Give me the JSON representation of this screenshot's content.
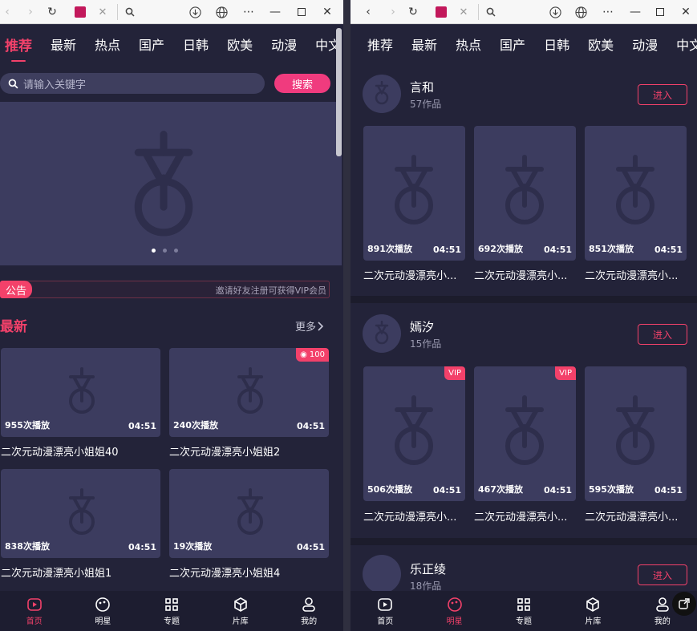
{
  "left": {
    "nav": [
      "推荐",
      "最新",
      "热点",
      "国产",
      "日韩",
      "欧美",
      "动漫",
      "中文"
    ],
    "search": {
      "placeholder": "请输入关键字",
      "button": "搜索"
    },
    "notice": {
      "tag": "公告",
      "text": "邀请好友注册可获得VIP会员"
    },
    "section": {
      "title": "最新",
      "more": "更多"
    },
    "videos": [
      {
        "plays": "955次播放",
        "duration": "04:51",
        "title": "二次元动漫漂亮小姐姐40"
      },
      {
        "plays": "240次播放",
        "duration": "04:51",
        "title": "二次元动漫漂亮小姐姐2",
        "badge": "100"
      },
      {
        "plays": "838次播放",
        "duration": "04:51",
        "title": "二次元动漫漂亮小姐姐1"
      },
      {
        "plays": "19次播放",
        "duration": "04:51",
        "title": "二次元动漫漂亮小姐姐4"
      }
    ],
    "tabs": [
      "首页",
      "明星",
      "专题",
      "片库",
      "我的"
    ]
  },
  "right": {
    "nav": [
      "推荐",
      "最新",
      "热点",
      "国产",
      "日韩",
      "欧美",
      "动漫",
      "中文"
    ],
    "enter": "进入",
    "stars": [
      {
        "name": "言和",
        "works": "57作品",
        "videos": [
          {
            "plays": "891次播放",
            "duration": "04:51",
            "title": "二次元动漫漂亮小..."
          },
          {
            "plays": "692次播放",
            "duration": "04:51",
            "title": "二次元动漫漂亮小..."
          },
          {
            "plays": "851次播放",
            "duration": "04:51",
            "title": "二次元动漫漂亮小..."
          }
        ]
      },
      {
        "name": "嫣汐",
        "works": "15作品",
        "videos": [
          {
            "plays": "506次播放",
            "duration": "04:51",
            "title": "二次元动漫漂亮小...",
            "badge": "VIP"
          },
          {
            "plays": "467次播放",
            "duration": "04:51",
            "title": "二次元动漫漂亮小...",
            "badge": "VIP"
          },
          {
            "plays": "595次播放",
            "duration": "04:51",
            "title": "二次元动漫漂亮小..."
          }
        ]
      },
      {
        "name": "乐正绫",
        "works": "18作品"
      }
    ],
    "tabs": [
      "首页",
      "明星",
      "专题",
      "片库",
      "我的"
    ]
  },
  "colors": {
    "accent": "#f3416a",
    "background": "#232339",
    "card": "#3c3c5f"
  }
}
